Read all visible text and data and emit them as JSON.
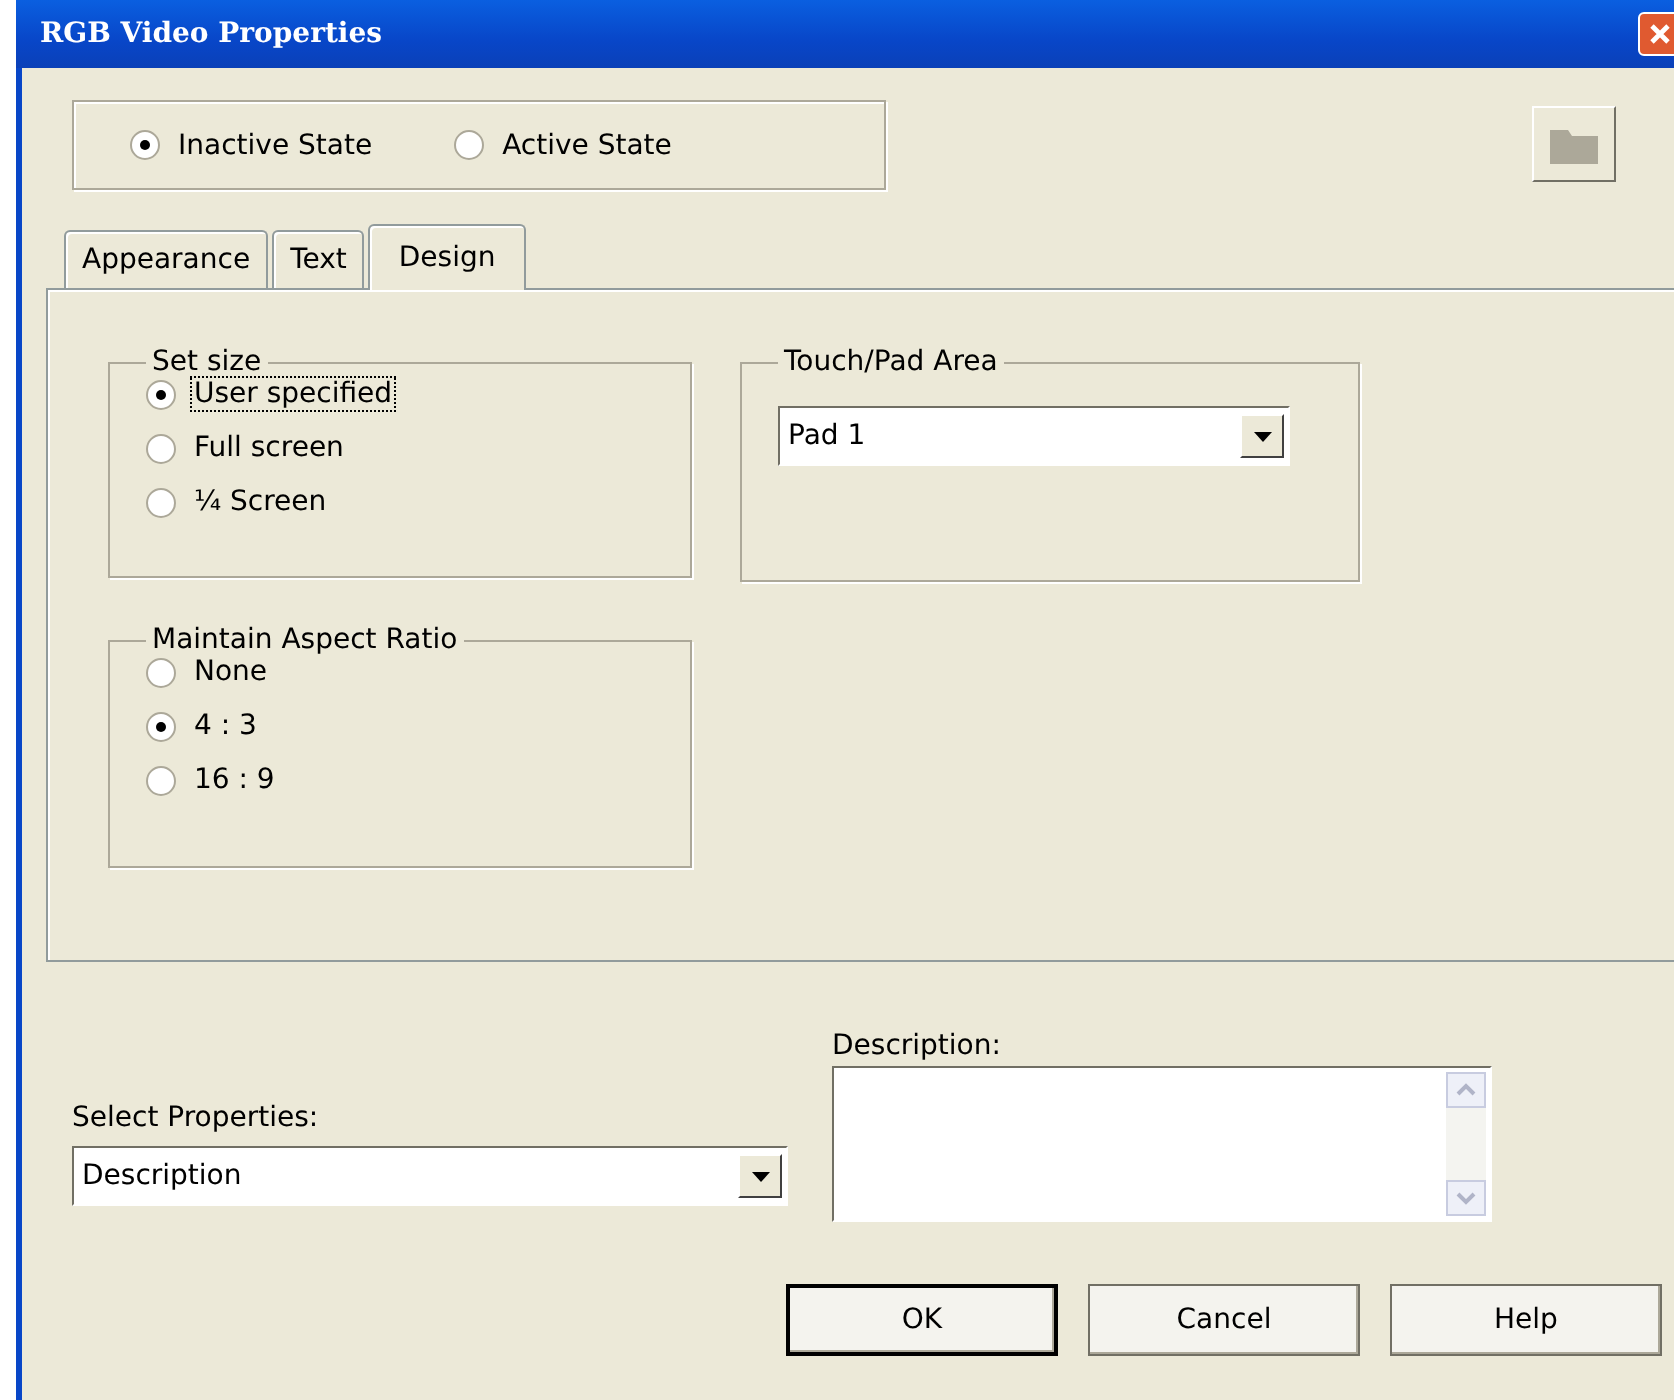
{
  "window": {
    "title": "RGB Video Properties"
  },
  "state_options": [
    {
      "label": "Inactive State",
      "selected": true
    },
    {
      "label": "Active State",
      "selected": false
    }
  ],
  "tabs": [
    {
      "label": "Appearance",
      "selected": false
    },
    {
      "label": "Text",
      "selected": false
    },
    {
      "label": "Design",
      "selected": true
    }
  ],
  "set_size": {
    "title": "Set size",
    "options": [
      {
        "label": "User specified",
        "selected": true,
        "focused": true
      },
      {
        "label": "Full screen",
        "selected": false,
        "focused": false
      },
      {
        "label": "¼ Screen",
        "selected": false,
        "focused": false
      }
    ]
  },
  "aspect_ratio": {
    "title": "Maintain Aspect Ratio",
    "options": [
      {
        "label": "None",
        "selected": false,
        "focused": false
      },
      {
        "label": "4 : 3",
        "selected": true,
        "focused": false
      },
      {
        "label": "16 : 9",
        "selected": false,
        "focused": false
      }
    ]
  },
  "touch_pad": {
    "title": "Touch/Pad Area",
    "value": "Pad 1"
  },
  "select_properties": {
    "label": "Select Properties:",
    "value": "Description"
  },
  "description": {
    "label": "Description:"
  },
  "buttons": [
    {
      "label": "OK",
      "default": true
    },
    {
      "label": "Cancel",
      "default": false
    },
    {
      "label": "Help",
      "default": false
    }
  ]
}
